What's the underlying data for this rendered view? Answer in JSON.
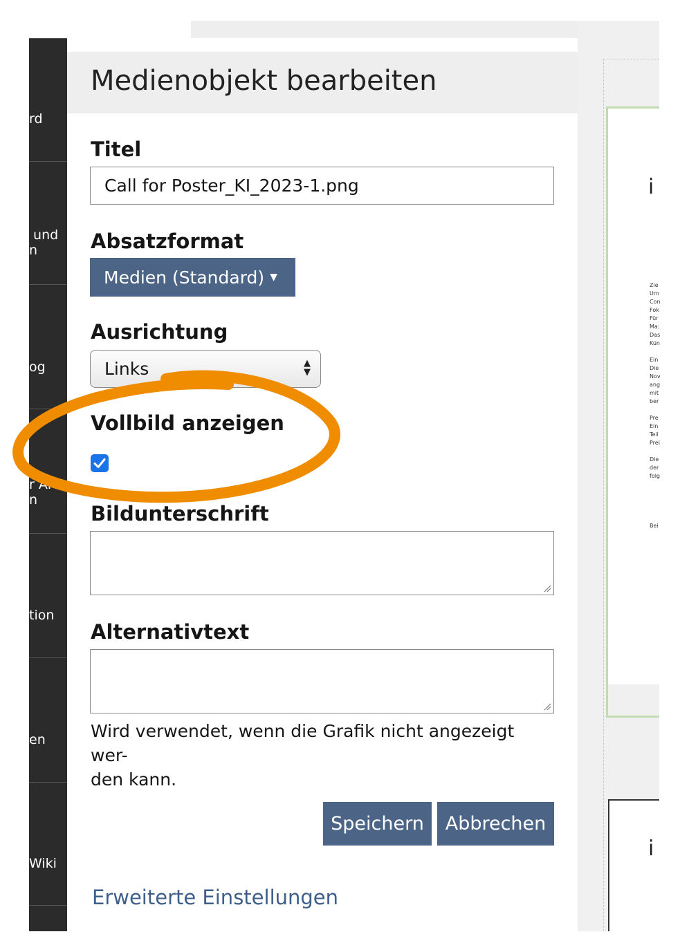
{
  "nav": {
    "items": [
      {
        "label": "rd"
      },
      {
        "label": " und\nn"
      },
      {
        "label": "og"
      },
      {
        "label": "r Ar\nn"
      },
      {
        "label": "tion"
      },
      {
        "label": "en"
      },
      {
        "label": "Wiki"
      }
    ]
  },
  "dialog": {
    "title": "Medienobjekt bearbeiten",
    "title_label": "Titel",
    "title_value": "Call for Poster_KI_2023-1.png",
    "format_label": "Absatzformat",
    "format_value": "Medien (Standard)",
    "align_label": "Ausrichtung",
    "align_value": "Links",
    "fullscreen_label": "Vollbild anzeigen",
    "fullscreen_checked": true,
    "caption_label": "Bildunterschrift",
    "caption_value": "",
    "alt_label": "Alternativtext",
    "alt_value": "",
    "alt_hint": "Wird verwendet, wenn die Grafik nicht angezeigt wer-\nden kann.",
    "save_label": "Speichern",
    "cancel_label": "Abbrechen",
    "advanced_link": "Erweiterte Einstellungen"
  },
  "preview": {
    "logo_letter": "i",
    "text_lines": "Zie\nUm\nCon\nFok\nFür\nMa:\nDas\nKün\n\nEin\nDie\nNov\nang\nmit\nber\n\nPre\nEin\nTeil\nPrei\n\nDie\nder\nfolg\n\n\n\n\n\nBei"
  },
  "colors": {
    "accent_button": "#4c6586",
    "checkbox": "#1a73e8",
    "annotation_circle": "#ef8c00",
    "link": "#3e5f8a"
  }
}
